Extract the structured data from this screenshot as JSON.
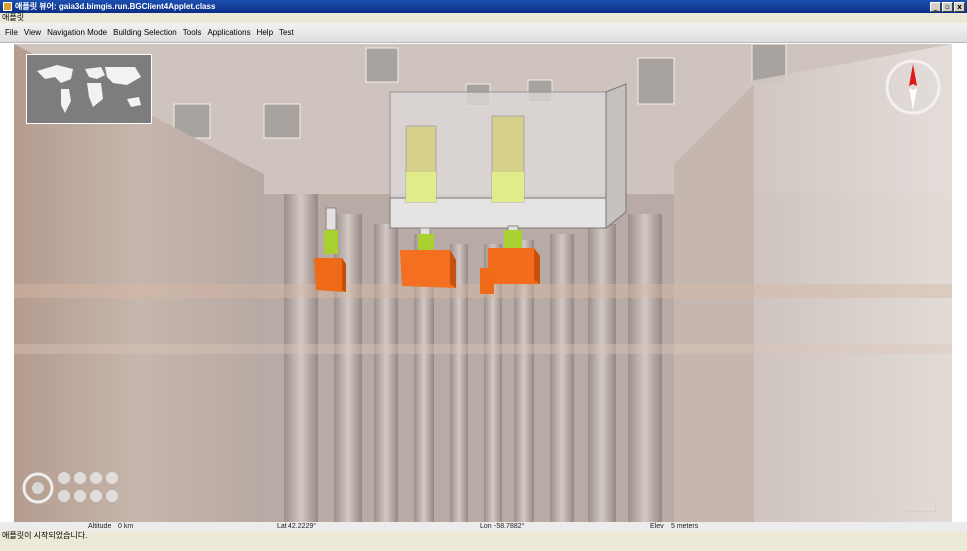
{
  "window": {
    "title": "애플릿 뷰어: gaia3d.bimgis.run.BGClient4Applet.class",
    "controls": [
      "_",
      "▫",
      "x"
    ]
  },
  "applet_menu": {
    "label": "애플릿"
  },
  "menubar": {
    "items": [
      "File",
      "View",
      "Navigation Mode",
      "Building Selection",
      "Tools",
      "Applications",
      "Help",
      "Test"
    ]
  },
  "statusbar": {
    "altitude_label": "Altitude",
    "altitude_value": "0 km",
    "lat_label": "Lat",
    "lat_value": "42.2229°",
    "lon_label": "Lon",
    "lon_value": "-58.7882°",
    "elev_label": "Elev",
    "elev_value": "5 meters"
  },
  "browser_status": {
    "text": "애플릿이 시작되었습니다."
  },
  "icons": {
    "minimap": "world-map-icon",
    "compass": "compass-icon",
    "navigation": "navigation-pad-icon"
  },
  "colors": {
    "title_bar": "#0a2f84",
    "highlight_box": "#ff6a1a",
    "connector": "#a8d030"
  }
}
